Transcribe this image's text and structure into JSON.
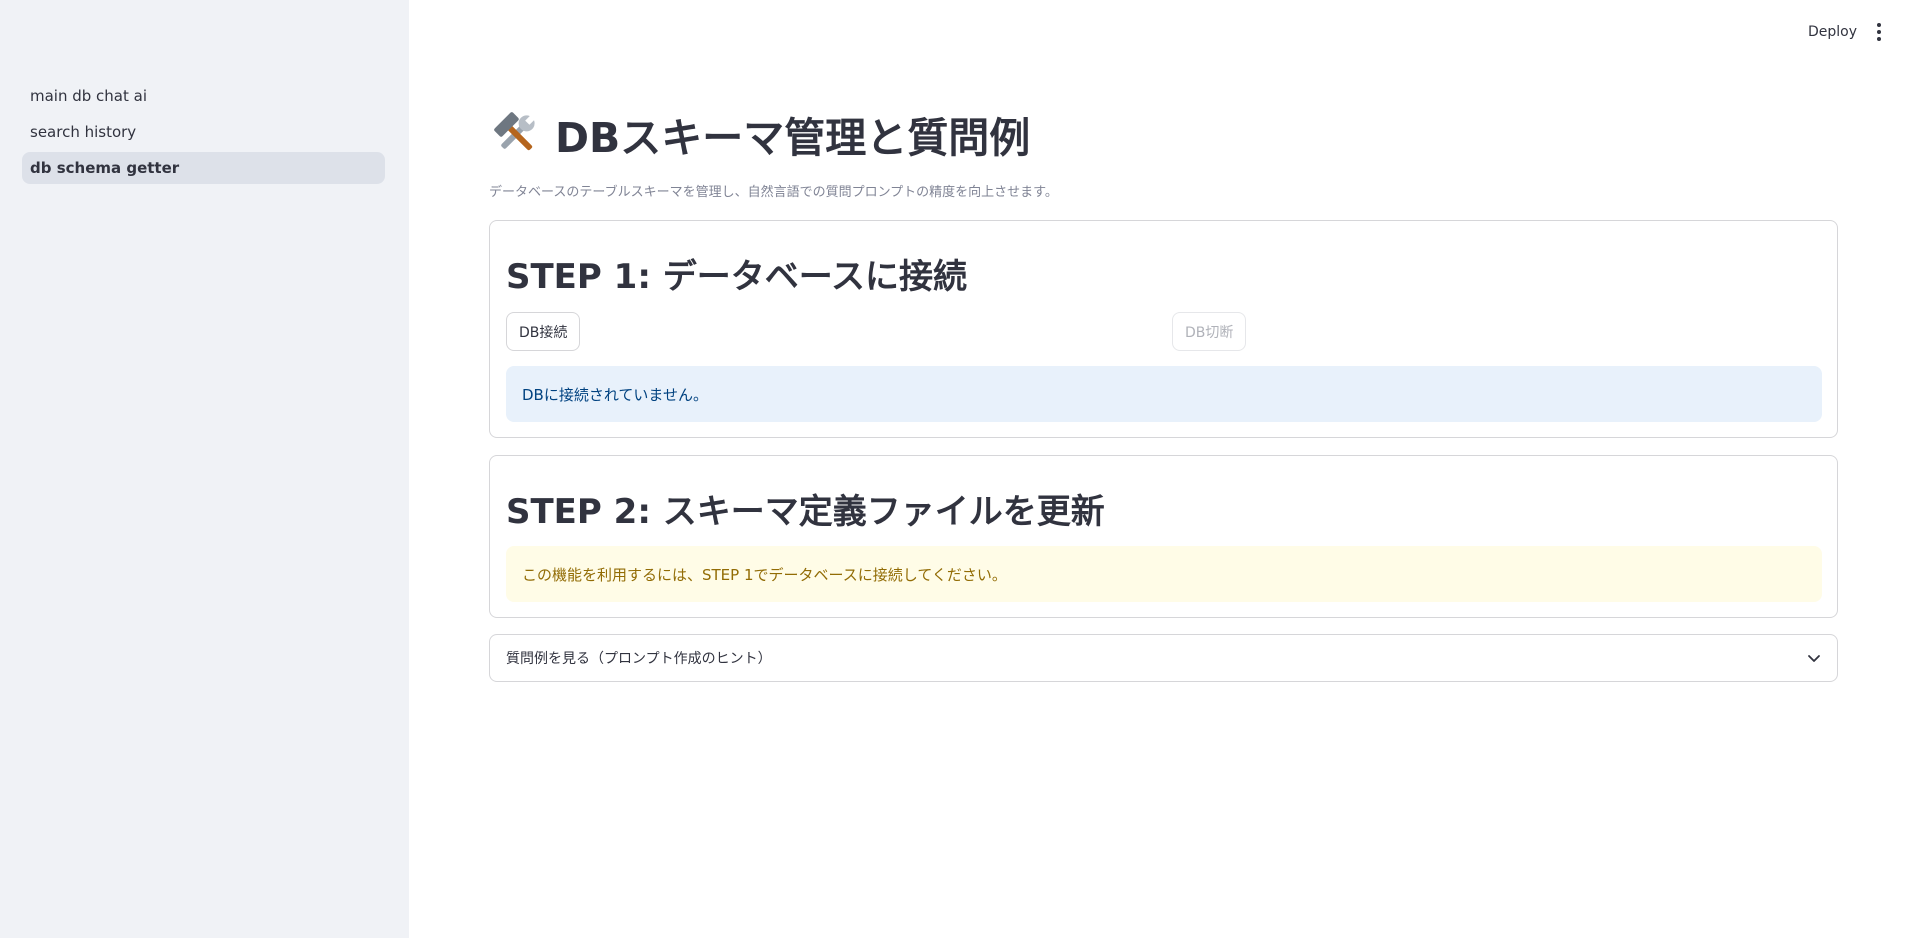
{
  "header": {
    "deploy_label": "Deploy",
    "menu_icon": "vertical-dots-icon"
  },
  "sidebar": {
    "items": [
      {
        "label": "main db chat ai",
        "active": false
      },
      {
        "label": "search history",
        "active": false
      },
      {
        "label": "db schema getter",
        "active": true
      }
    ]
  },
  "main": {
    "title_icon": "hammer-and-wrench-icon",
    "title": "DBスキーマ管理と質問例",
    "subtitle": "データベースのテーブルスキーマを管理し、自然言語での質問プロンプトの精度を向上させます。",
    "step1": {
      "heading": "STEP 1: データベースに接続",
      "connect_label": "DB接続",
      "disconnect_label": "DB切断",
      "info_message": "DBに接続されていません。"
    },
    "step2": {
      "heading": "STEP 2: スキーマ定義ファイルを更新",
      "warning_message": "この機能を利用するには、STEP 1でデータベースに接続してください。"
    },
    "expander": {
      "label": "質問例を見る（プロンプト作成のヒント）",
      "icon": "chevron-down-icon"
    }
  },
  "colors": {
    "sidebar_bg": "#f0f2f6",
    "active_item_bg": "#dde1e9",
    "info_bg": "#e8f1fb",
    "info_text": "#004280",
    "warning_bg": "#fffce7",
    "warning_text": "#926c05"
  }
}
